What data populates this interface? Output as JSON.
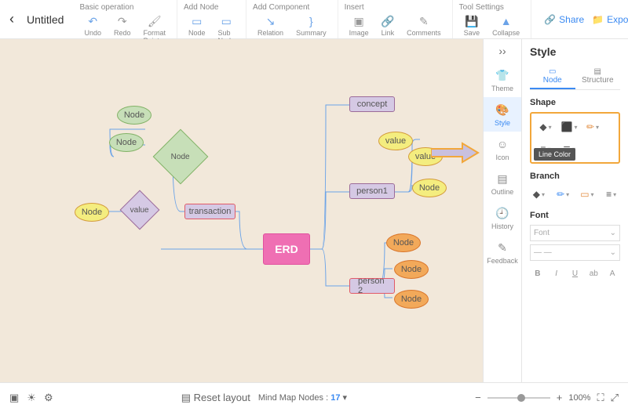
{
  "title": "Untitled",
  "toolbar": {
    "groups": [
      {
        "label": "Basic operation",
        "items": [
          {
            "name": "undo",
            "label": "Undo",
            "glyph": "↶"
          },
          {
            "name": "redo",
            "label": "Redo",
            "glyph": "↷"
          },
          {
            "name": "format-painter",
            "label": "Format Painter",
            "glyph": "🖌"
          }
        ]
      },
      {
        "label": "Add Node",
        "items": [
          {
            "name": "node",
            "label": "Node",
            "glyph": "▭"
          },
          {
            "name": "sub-node",
            "label": "Sub Node",
            "glyph": "▭"
          }
        ]
      },
      {
        "label": "Add Component",
        "items": [
          {
            "name": "relation",
            "label": "Relation",
            "glyph": "↘"
          },
          {
            "name": "summary",
            "label": "Summary",
            "glyph": "}"
          }
        ]
      },
      {
        "label": "Insert",
        "items": [
          {
            "name": "image",
            "label": "Image",
            "glyph": "▣"
          },
          {
            "name": "link",
            "label": "Link",
            "glyph": "🔗"
          },
          {
            "name": "comments",
            "label": "Comments",
            "glyph": "✎"
          }
        ]
      },
      {
        "label": "Tool Settings",
        "items": [
          {
            "name": "save",
            "label": "Save",
            "glyph": "💾"
          },
          {
            "name": "collapse",
            "label": "Collapse",
            "glyph": "▲"
          }
        ]
      }
    ]
  },
  "header_actions": {
    "share": "Share",
    "export": "Export"
  },
  "side_rail": {
    "toggle_glyph": "››",
    "items": [
      {
        "name": "theme",
        "label": "Theme",
        "glyph": "👕"
      },
      {
        "name": "style",
        "label": "Style",
        "glyph": "🎨",
        "active": true
      },
      {
        "name": "icon",
        "label": "Icon",
        "glyph": "☺"
      },
      {
        "name": "outline",
        "label": "Outline",
        "glyph": "▤"
      },
      {
        "name": "history",
        "label": "History",
        "glyph": "🕘"
      },
      {
        "name": "feedback",
        "label": "Feedback",
        "glyph": "✎"
      }
    ]
  },
  "panel": {
    "title": "Style",
    "tabs": [
      {
        "name": "node",
        "label": "Node",
        "glyph": "▭",
        "active": true
      },
      {
        "name": "structure",
        "label": "Structure",
        "glyph": "▤"
      }
    ],
    "shape_label": "Shape",
    "branch_label": "Branch",
    "font_label": "Font",
    "tooltip": "Line Color",
    "font_placeholder": "Font"
  },
  "footer": {
    "reset": "Reset layout",
    "count_label": "Mind Map Nodes :",
    "count_value": "17",
    "zoom_label": "100%"
  },
  "mindmap": {
    "center": "ERD",
    "left": {
      "transaction": "transaction",
      "value": "value",
      "node_l1": "Node",
      "big_node": "Node",
      "node_top1": "Node",
      "node_top2": "Node"
    },
    "right": {
      "concept": "concept",
      "value1": "value",
      "value2": "value",
      "person1": "person1",
      "p1_node": "Node",
      "person2": "person 2",
      "p2_node1": "Node",
      "p2_node2": "Node",
      "p2_node3": "Node"
    }
  }
}
